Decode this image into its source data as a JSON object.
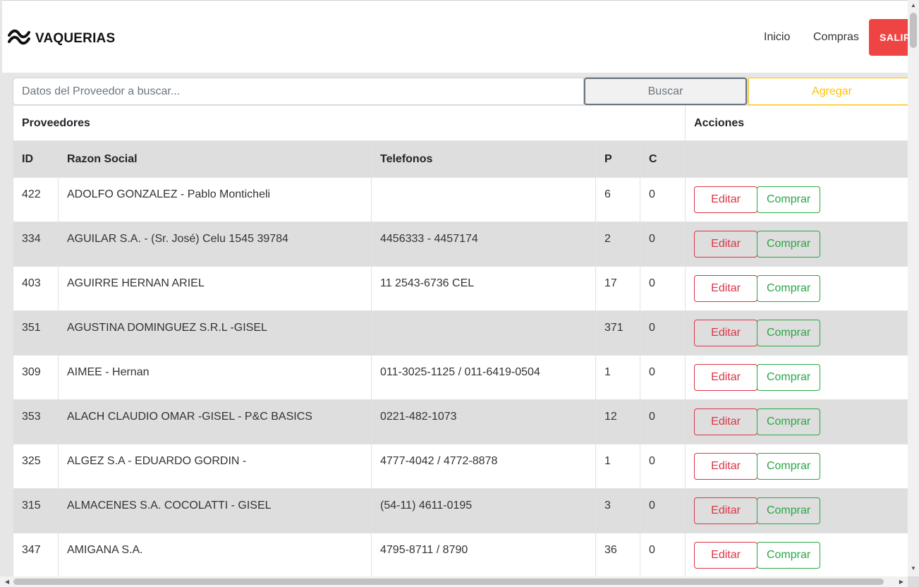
{
  "navbar": {
    "brand_icon": "wave-icon",
    "brand": "VAQUERIAS",
    "links": [
      "Inicio",
      "Compras"
    ],
    "logout_label": "SALIR"
  },
  "search": {
    "placeholder": "Datos del Proveedor a buscar...",
    "search_label": "Buscar",
    "add_label": "Agregar"
  },
  "table": {
    "group_headers": {
      "providers": "Proveedores",
      "actions": "Acciones"
    },
    "columns": {
      "id": "ID",
      "razon": "Razon Social",
      "tel": "Telefonos",
      "p": "P",
      "c": "C"
    },
    "edit_label": "Editar",
    "buy_label": "Comprar",
    "rows": [
      {
        "id": "422",
        "razon": "ADOLFO GONZALEZ - Pablo Monticheli",
        "tel": "",
        "p": "6",
        "c": "0"
      },
      {
        "id": "334",
        "razon": "AGUILAR S.A. - (Sr. José) Celu 1545 39784",
        "tel": "4456333 - 4457174",
        "p": "2",
        "c": "0"
      },
      {
        "id": "403",
        "razon": "AGUIRRE HERNAN ARIEL",
        "tel": "11 2543-6736 CEL",
        "p": "17",
        "c": "0"
      },
      {
        "id": "351",
        "razon": "AGUSTINA DOMINGUEZ S.R.L -GISEL",
        "tel": "",
        "p": "371",
        "c": "0"
      },
      {
        "id": "309",
        "razon": "AIMEE - Hernan",
        "tel": "011-3025-1125 / 011-6419-0504",
        "p": "1",
        "c": "0"
      },
      {
        "id": "353",
        "razon": "ALACH CLAUDIO OMAR -GISEL - P&C BASICS",
        "tel": "0221-482-1073",
        "p": "12",
        "c": "0"
      },
      {
        "id": "325",
        "razon": "ALGEZ S.A - EDUARDO GORDIN -",
        "tel": "4777-4042 / 4772-8878",
        "p": "1",
        "c": "0"
      },
      {
        "id": "315",
        "razon": "ALMACENES S.A. COCOLATTI - GISEL",
        "tel": "(54-11) 4611-0195",
        "p": "3",
        "c": "0"
      },
      {
        "id": "347",
        "razon": "AMIGANA S.A.",
        "tel": "4795-8711 / 8790",
        "p": "36",
        "c": "0"
      }
    ]
  },
  "colors": {
    "danger": "#dc3545",
    "success": "#28a745",
    "warning": "#ffc107",
    "logout": "#ef4444",
    "stripe": "#dedede"
  }
}
